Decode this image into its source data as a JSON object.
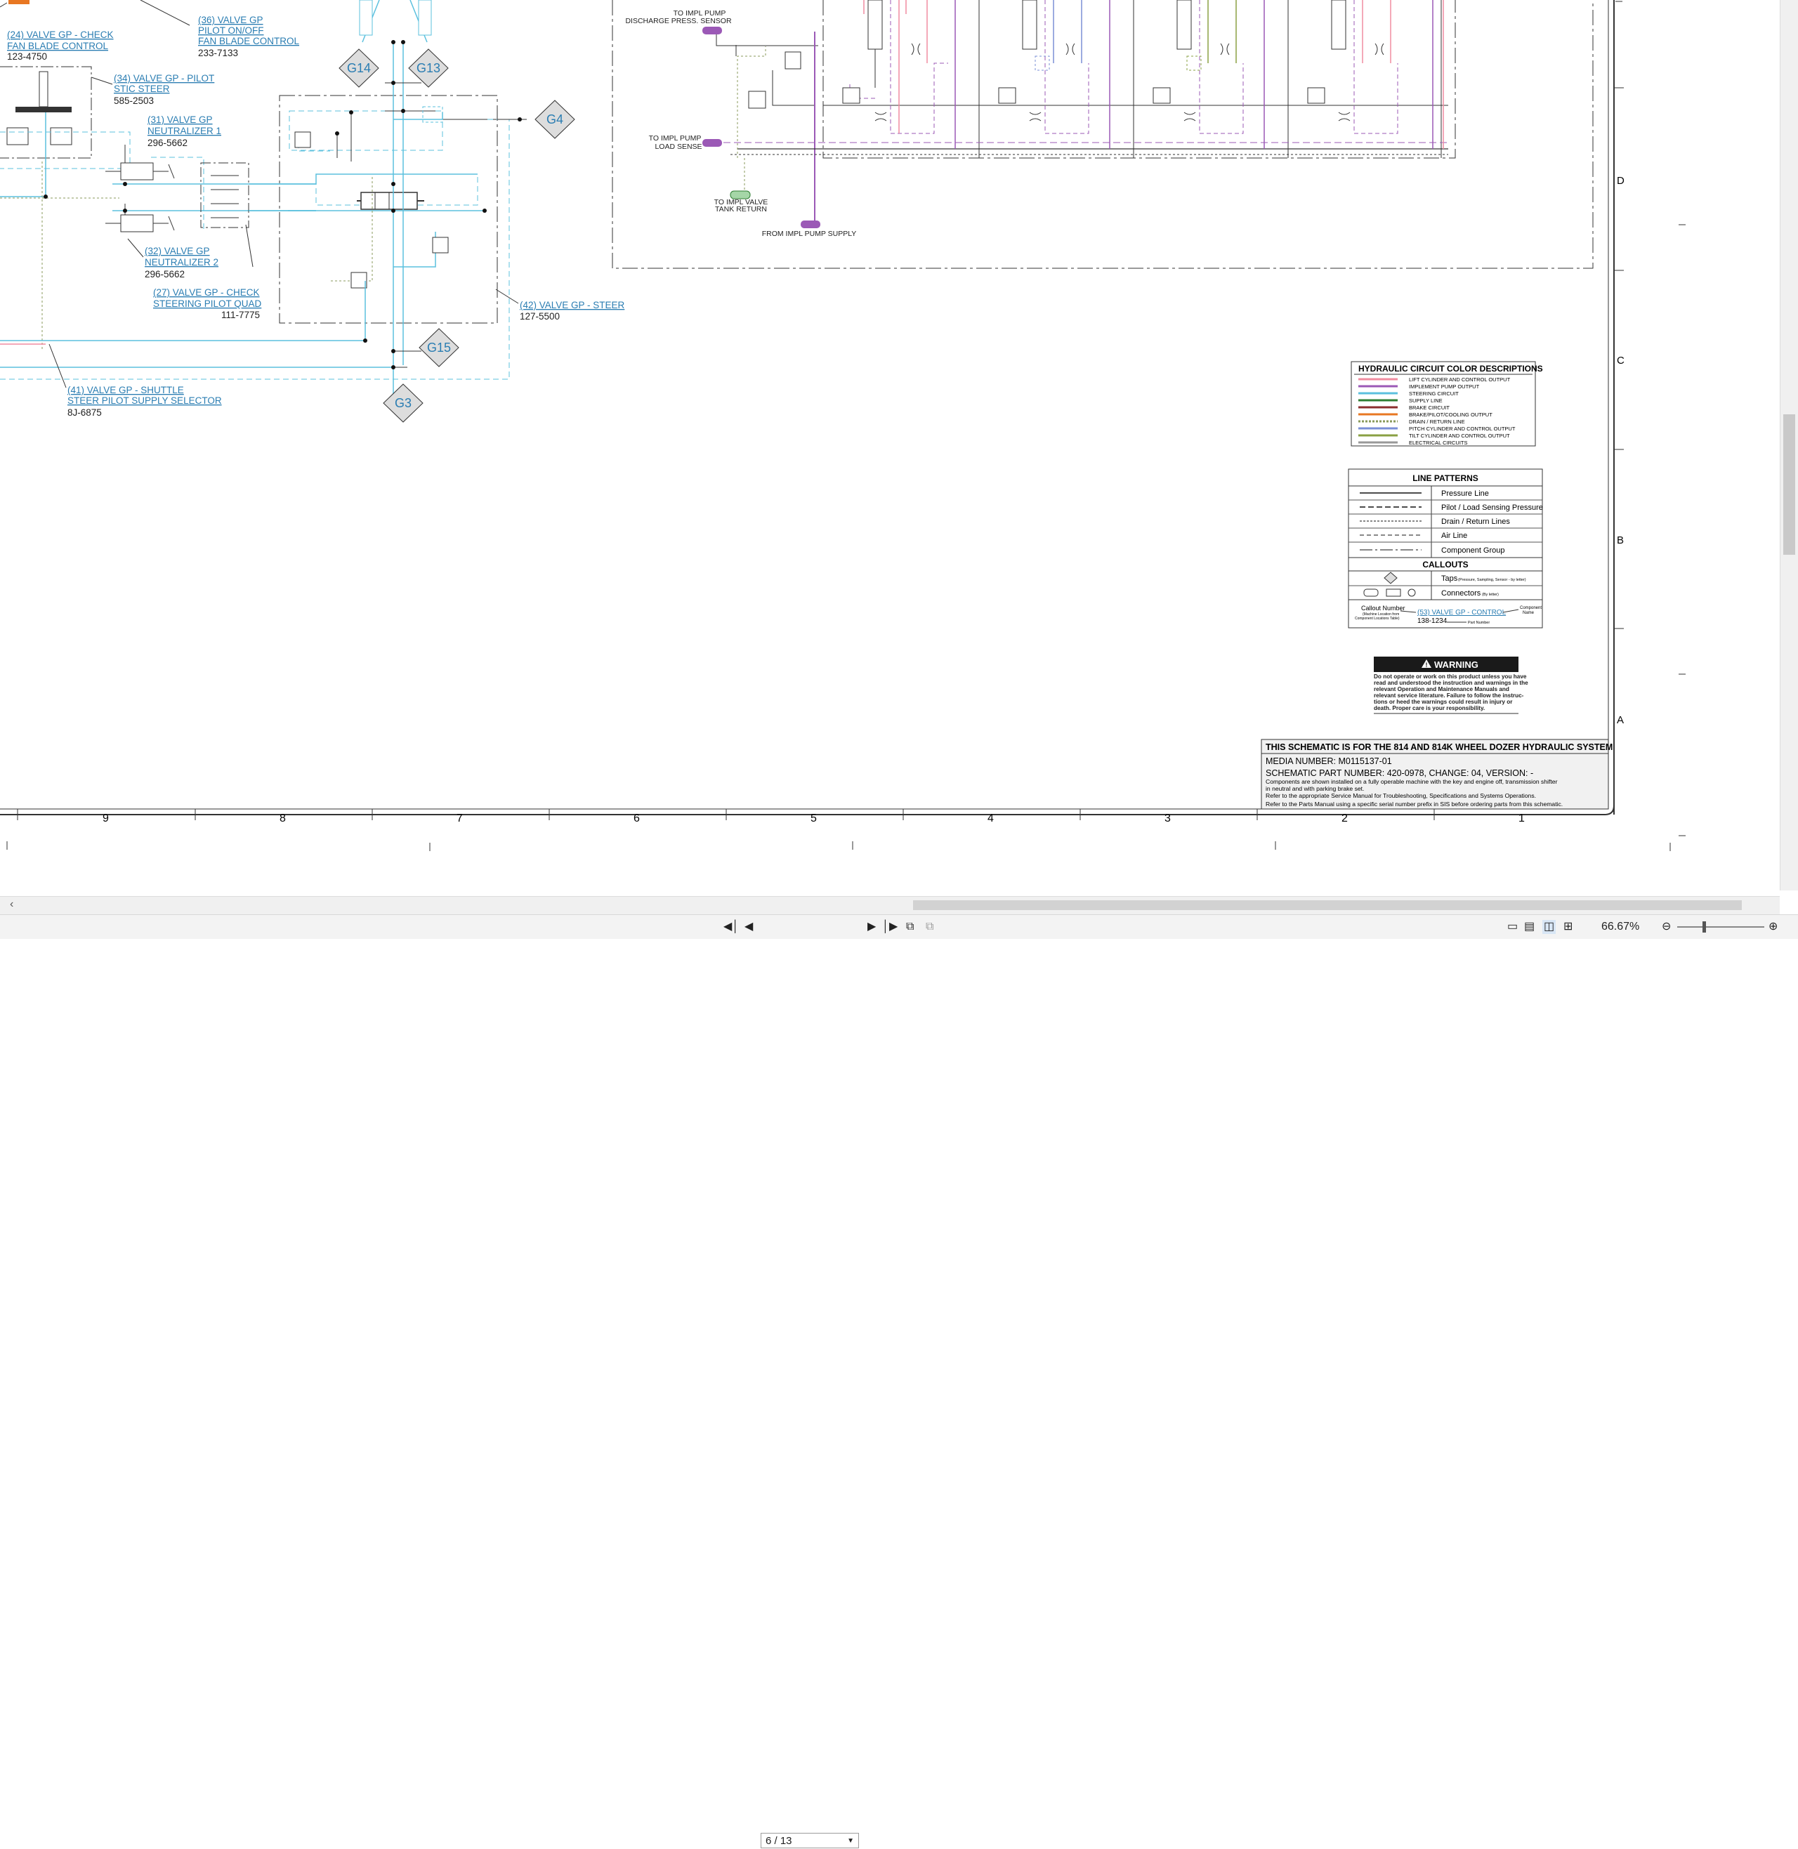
{
  "callouts": [
    {
      "name": "(24) VALVE GP - CHECK",
      "name2": "FAN BLADE CONTROL",
      "part": "123-4750"
    },
    {
      "name": "(36) VALVE GP",
      "name2": "PILOT ON/OFF",
      "name3": "FAN BLADE CONTROL",
      "part": "233-7133"
    },
    {
      "name": "(34) VALVE GP - PILOT",
      "name2": "STIC STEER",
      "part": "585-2503"
    },
    {
      "name": "(31) VALVE GP",
      "name2": "NEUTRALIZER 1",
      "part": "296-5662"
    },
    {
      "name": "(32) VALVE GP",
      "name2": "NEUTRALIZER 2",
      "part": "296-5662"
    },
    {
      "name": "(27) VALVE GP - CHECK",
      "name2": "STEERING PILOT QUAD",
      "part": "111-7775"
    },
    {
      "name": "(42) VALVE GP - STEER",
      "part": "127-5500"
    },
    {
      "name": "(41) VALVE GP - SHUTTLE",
      "name2": "STEER PILOT SUPPLY SELECTOR",
      "part": "8J-6875"
    }
  ],
  "taps": [
    "G14",
    "G13",
    "G4",
    "G15",
    "G3"
  ],
  "impl_labels": {
    "discharge_1": "TO IMPL PUMP",
    "discharge_2": "DISCHARGE PRESS. SENSOR",
    "load_1": "TO IMPL PUMP",
    "load_2": "LOAD SENSE",
    "tank_1": "TO IMPL VALVE",
    "tank_2": "TANK RETURN",
    "supply": "FROM IMPL PUMP SUPPLY"
  },
  "color_legend": {
    "title": "HYDRAULIC CIRCUIT COLOR DESCRIPTIONS",
    "items": [
      {
        "label": "LIFT CYLINDER AND CONTROL OUTPUT",
        "color": "#f08ca0"
      },
      {
        "label": "IMPLEMENT PUMP OUTPUT",
        "color": "#9b59b6"
      },
      {
        "label": "STEERING CIRCUIT",
        "color": "#5bc0de"
      },
      {
        "label": "SUPPLY LINE",
        "color": "#2e7d32"
      },
      {
        "label": "BRAKE CIRCUIT",
        "color": "#8b2d2d"
      },
      {
        "label": "BRAKE/PILOT/COOLING OUTPUT",
        "color": "#e87722"
      },
      {
        "label": "DRAIN / RETURN LINE",
        "color": "#8a9a5b"
      },
      {
        "label": "PITCH CYLINDER AND CONTROL OUTPUT",
        "color": "#7a8fd6"
      },
      {
        "label": "TILT CYLINDER AND CONTROL OUTPUT",
        "color": "#8aa043"
      },
      {
        "label": "ELECTRICAL CIRCUITS",
        "color": "#999999"
      }
    ]
  },
  "line_patterns": {
    "title": "LINE PATTERNS",
    "items": [
      "Pressure Line",
      "Pilot / Load Sensing Pressure",
      "Drain / Return Lines",
      "Air Line",
      "Component Group"
    ],
    "callouts_title": "CALLOUTS",
    "taps_label": "Taps",
    "taps_note": "(Pressure, Sampling, Sensor - by letter)",
    "connectors_label": "Connectors",
    "connectors_note": "(By letter)",
    "callout_number": "Callout Number",
    "callout_number_note1": "(Machine Location from",
    "callout_number_note2": "Component Locations Table)",
    "example_name": "(53) VALVE GP - CONTROL",
    "example_part": "138-1234",
    "component_name_1": "Component",
    "component_name_2": "Name",
    "part_number": "Part Number"
  },
  "warning": {
    "title": "WARNING",
    "lines": [
      "Do not operate or work on this product unless you have",
      "read and understood the instruction and warnings in the",
      "relevant Operation and Maintenance Manuals and",
      "relevant service literature. Failure to follow the instruc-",
      "tions or heed the warnings could result in injury or",
      "death. Proper care is your responsibility."
    ]
  },
  "title_block": {
    "title": "THIS SCHEMATIC IS FOR THE 814 AND 814K WHEEL DOZER HYDRAULIC SYSTEM",
    "media": "MEDIA NUMBER: M0115137-01",
    "part": "SCHEMATIC PART NUMBER: 420-0978, CHANGE: 04, VERSION: -",
    "note1": "Components are shown installed on a fully operable machine with the key and engine off, transmission shifter",
    "note2": "in neutral and with parking brake set.",
    "note3": "Refer to the appropriate Service Manual for Troubleshooting, Specifications and Systems Operations.",
    "note4": "Refer to the Parts Manual using a specific serial number prefix in SIS before ordering parts from this schematic."
  },
  "zones_right": [
    "D",
    "C",
    "B",
    "A"
  ],
  "zones_bottom": [
    "9",
    "8",
    "7",
    "6",
    "5",
    "4",
    "3",
    "2",
    "1"
  ],
  "viewer": {
    "page_current": "6 / 13",
    "zoom": "66.67%",
    "zoom_level": 0.3
  }
}
